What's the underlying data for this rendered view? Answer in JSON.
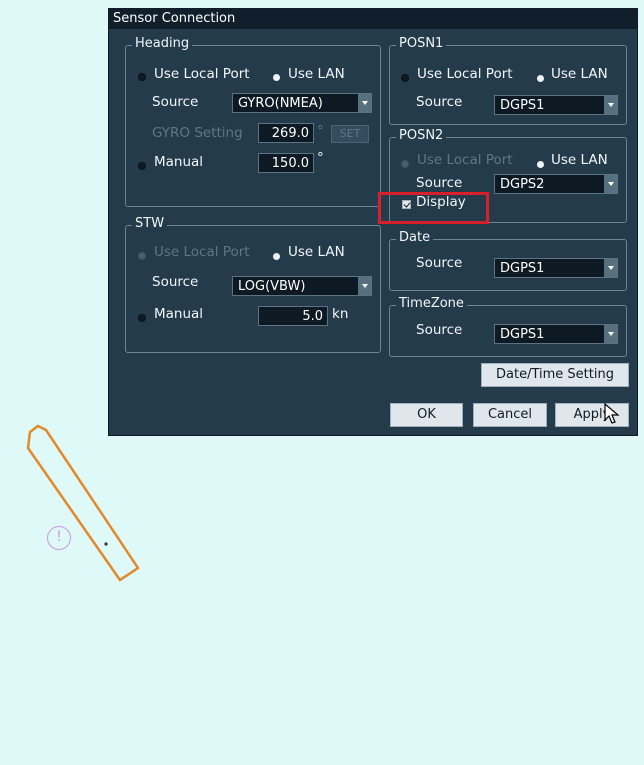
{
  "dialog": {
    "title": "Sensor Connection",
    "heading": {
      "title": "Heading",
      "use_local_port": "Use Local Port",
      "use_lan": "Use LAN",
      "source_label": "Source",
      "source_value": "GYRO(NMEA)",
      "gyro_setting_label": "GYRO Setting",
      "gyro_setting_value": "269.0",
      "gyro_unit": "°",
      "set_button": "SET",
      "manual_label": "Manual",
      "manual_value": "150.0",
      "manual_unit": "°"
    },
    "stw": {
      "title": "STW",
      "use_local_port": "Use Local Port",
      "use_lan": "Use LAN",
      "source_label": "Source",
      "source_value": "LOG(VBW)",
      "manual_label": "Manual",
      "manual_value": "5.0",
      "manual_unit": "kn"
    },
    "posn1": {
      "title": "POSN1",
      "use_local_port": "Use Local Port",
      "use_lan": "Use LAN",
      "source_label": "Source",
      "source_value": "DGPS1"
    },
    "posn2": {
      "title": "POSN2",
      "use_local_port": "Use Local Port",
      "use_lan": "Use LAN",
      "source_label": "Source",
      "source_value": "DGPS2",
      "display_label": "Display"
    },
    "date": {
      "title": "Date",
      "source_label": "Source",
      "source_value": "DGPS1"
    },
    "timezone": {
      "title": "TimeZone",
      "source_label": "Source",
      "source_value": "DGPS1"
    },
    "buttons": {
      "date_time_setting": "Date/Time Setting",
      "ok": "OK",
      "cancel": "Cancel",
      "apply": "Apply"
    }
  },
  "map": {
    "alert_symbol": "!"
  },
  "colors": {
    "dialog_bg": "#243b4c",
    "highlight": "#d8202c",
    "vessel_outline": "#e08a2a",
    "alert_circle": "#c79be0",
    "map_bg": "#dff8f8"
  }
}
